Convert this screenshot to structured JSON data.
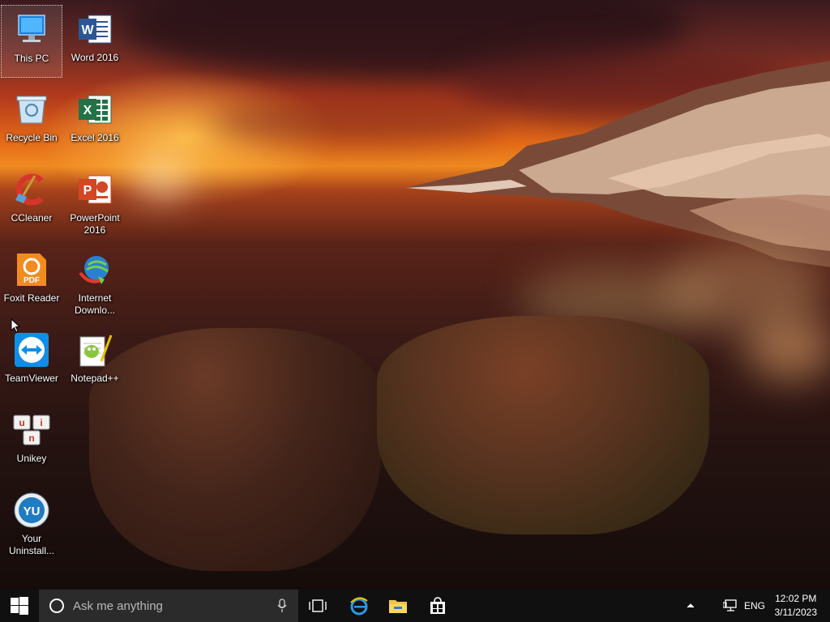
{
  "desktop": {
    "icons": [
      {
        "label": "This PC",
        "icon": "this-pc-icon"
      },
      {
        "label": "Word 2016",
        "icon": "word-icon"
      },
      {
        "label": "Recycle Bin",
        "icon": "recycle-bin-icon"
      },
      {
        "label": "Excel 2016",
        "icon": "excel-icon"
      },
      {
        "label": "CCleaner",
        "icon": "ccleaner-icon"
      },
      {
        "label": "PowerPoint 2016",
        "icon": "powerpoint-icon"
      },
      {
        "label": "Foxit Reader",
        "icon": "foxit-reader-icon"
      },
      {
        "label": "Internet Downlo...",
        "icon": "internet-download-manager-icon"
      },
      {
        "label": "TeamViewer",
        "icon": "teamviewer-icon"
      },
      {
        "label": "Notepad++",
        "icon": "notepad-plus-plus-icon"
      },
      {
        "label": "Unikey",
        "icon": "unikey-icon"
      },
      {
        "label": "Your Uninstall...",
        "icon": "your-uninstaller-icon"
      }
    ]
  },
  "taskbar": {
    "search_placeholder": "Ask me anything",
    "language": "ENG",
    "time": "12:02 PM",
    "date": "3/11/2023",
    "pinned": [
      "edge-icon",
      "file-explorer-icon",
      "store-icon"
    ]
  },
  "colors": {
    "taskbar": "#101010",
    "search_box": "#2b2b2b",
    "windows_accent": "#ffffff"
  }
}
